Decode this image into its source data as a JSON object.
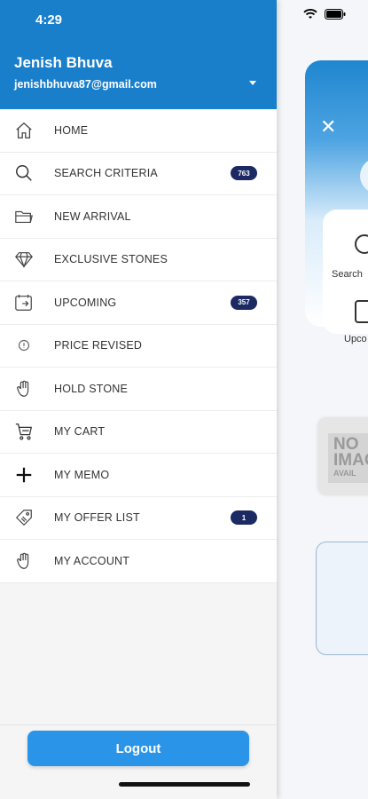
{
  "status_bar": {
    "time": "4:29"
  },
  "user": {
    "name": "Jenish Bhuva",
    "email": "jenishbhuva87@gmail.com"
  },
  "menu": [
    {
      "label": "HOME",
      "icon": "home-icon",
      "badge": null
    },
    {
      "label": "SEARCH CRITERIA",
      "icon": "search-icon",
      "badge": "763"
    },
    {
      "label": "NEW ARRIVAL",
      "icon": "folder-icon",
      "badge": null
    },
    {
      "label": "EXCLUSIVE STONES",
      "icon": "diamond-icon",
      "badge": null
    },
    {
      "label": "UPCOMING",
      "icon": "calendar-arrow-icon",
      "badge": "357"
    },
    {
      "label": "PRICE REVISED",
      "icon": "price-icon",
      "badge": null
    },
    {
      "label": "HOLD STONE",
      "icon": "hand-icon",
      "badge": null
    },
    {
      "label": "MY CART",
      "icon": "cart-icon",
      "badge": null
    },
    {
      "label": "MY MEMO",
      "icon": "plus-icon",
      "badge": null
    },
    {
      "label": "MY OFFER LIST",
      "icon": "tag-icon",
      "badge": "1"
    },
    {
      "label": "MY ACCOUNT",
      "icon": "hand-icon",
      "badge": null
    }
  ],
  "footer": {
    "logout_label": "Logout"
  },
  "background_app": {
    "label_search": "Search",
    "label_upcoming": "Upco",
    "no_image_line1": "NO",
    "no_image_line2": "IMAG",
    "no_image_line3": "AVAIL"
  },
  "colors": {
    "header": "#1a7fcb",
    "badge": "#1c2a63",
    "logout": "#2a95e8"
  }
}
